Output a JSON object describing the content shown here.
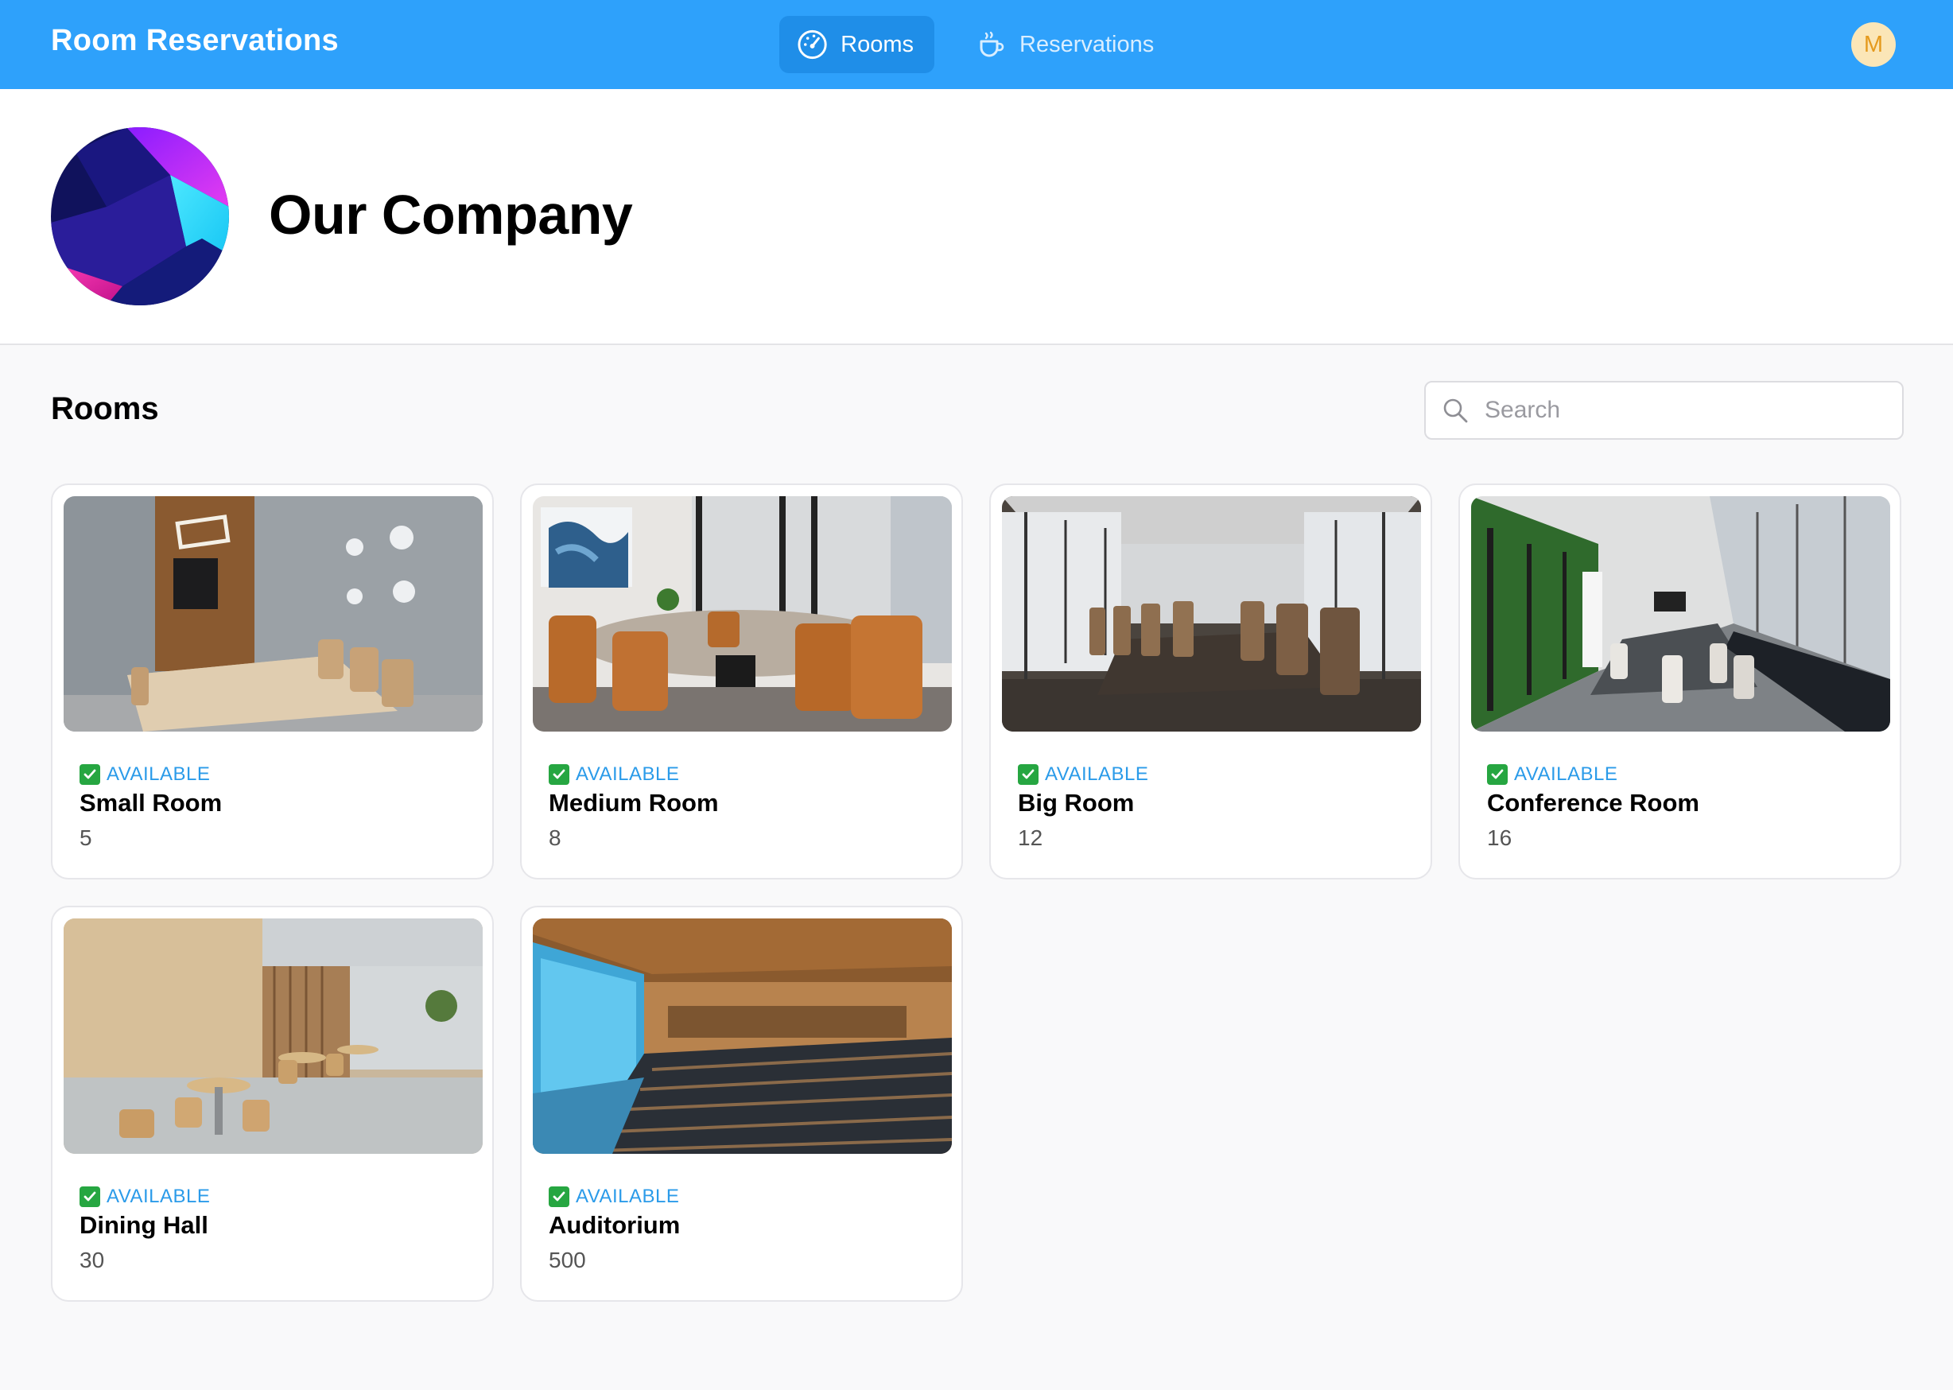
{
  "header": {
    "app_title": "Room Reservations",
    "tabs": [
      {
        "label": "Rooms",
        "icon": "gauge-icon",
        "active": true
      },
      {
        "label": "Reservations",
        "icon": "coffee-cup-icon",
        "active": false
      }
    ],
    "avatar_initial": "M"
  },
  "company": {
    "name": "Our Company",
    "logo_icon": "company-logo"
  },
  "rooms_section": {
    "title": "Rooms",
    "search_placeholder": "Search"
  },
  "rooms": [
    {
      "status": "AVAILABLE",
      "name": "Small Room",
      "capacity": "5",
      "photo": "small-room-photo"
    },
    {
      "status": "AVAILABLE",
      "name": "Medium Room",
      "capacity": "8",
      "photo": "medium-room-photo"
    },
    {
      "status": "AVAILABLE",
      "name": "Big Room",
      "capacity": "12",
      "photo": "big-room-photo"
    },
    {
      "status": "AVAILABLE",
      "name": "Conference Room",
      "capacity": "16",
      "photo": "conference-room-photo"
    },
    {
      "status": "AVAILABLE",
      "name": "Dining Hall",
      "capacity": "30",
      "photo": "dining-hall-photo"
    },
    {
      "status": "AVAILABLE",
      "name": "Auditorium",
      "capacity": "500",
      "photo": "auditorium-photo"
    }
  ],
  "colors": {
    "header_bg": "#2ea1fb",
    "active_tab_bg": "#1f8ee8",
    "status_text": "#2b9be9",
    "status_check": "#26a641",
    "avatar_bg": "#fbe6b7"
  }
}
